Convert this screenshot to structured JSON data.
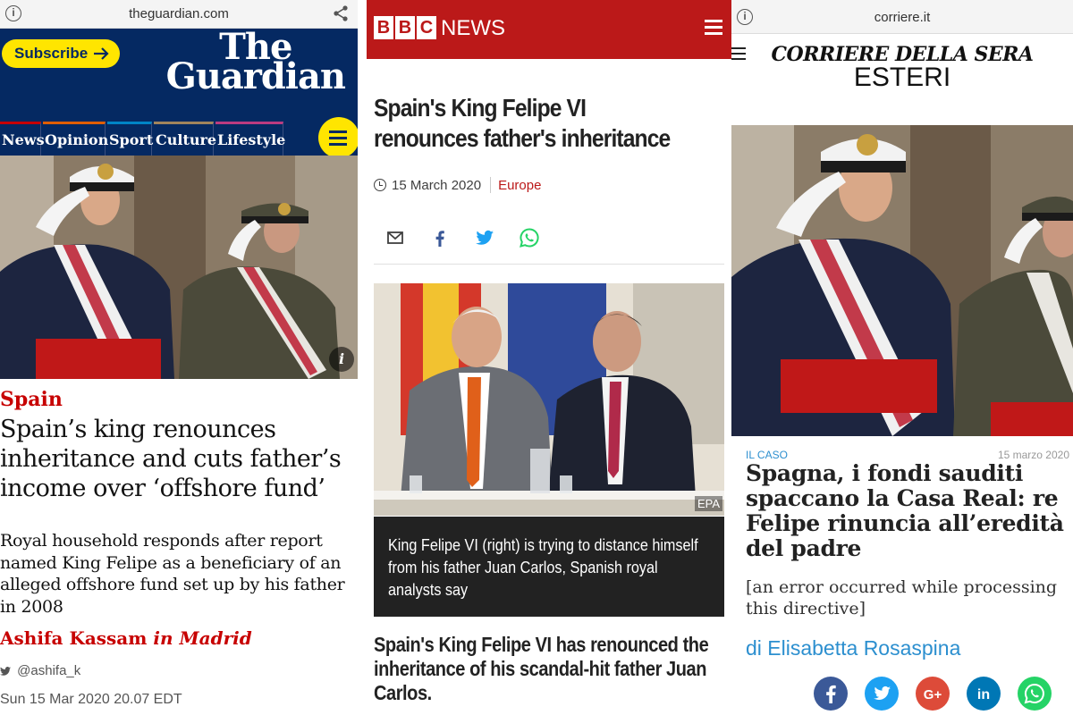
{
  "guardian": {
    "url": "theguardian.com",
    "subscribe_label": "Subscribe",
    "logo_line1": "The",
    "logo_line2": "Guardian",
    "nav": [
      {
        "label": "News",
        "color": "#c70000"
      },
      {
        "label": "Opinion",
        "color": "#e05e00"
      },
      {
        "label": "Sport",
        "color": "#0084c6"
      },
      {
        "label": "Culture",
        "color": "#a1845c"
      },
      {
        "label": "Lifestyle",
        "color": "#bb3b80"
      }
    ],
    "kicker": "Spain",
    "headline": "Spain’s king renounces inheritance and cuts father’s income over ‘offshore fund’",
    "standfirst": "Royal household responds after report named King Felipe as a beneficiary of an alleged offshore fund set up by his father in 2008",
    "byline_name": "Ashifa Kassam",
    "byline_location": "in Madrid",
    "twitter": "@ashifa_k",
    "date": "Sun 15 Mar 2020 20.07 EDT",
    "brand_color": "#052962",
    "accent_yellow": "#ffe500"
  },
  "bbc": {
    "logo_letters": [
      "B",
      "B",
      "C"
    ],
    "logo_news": "NEWS",
    "title": "Spain's King Felipe VI renounces father's inheritance",
    "date": "15 March 2020",
    "category": "Europe",
    "share_icons": [
      "email-icon",
      "facebook-icon",
      "twitter-icon",
      "whatsapp-icon"
    ],
    "photo_credit": "EPA",
    "caption": "King Felipe VI (right) is trying to distance himself from his father Juan Carlos, Spanish royal analysts say",
    "lead": "Spain's King Felipe VI has renounced the inheritance of his scandal-hit father Juan Carlos.",
    "brand_color": "#bb1919"
  },
  "corriere": {
    "url": "corriere.it",
    "brand": "CORRIERE DELLA SERA",
    "section": "ESTERI",
    "kicker": "IL CASO",
    "date": "15 marzo 2020",
    "title": "Spagna, i fondi sauditi spaccano la Casa Real: re Felipe rinuncia all’eredità del padre",
    "subtitle": "[an error occurred while processing this directive]",
    "author": "di Elisabetta Rosaspina",
    "social_icons": [
      "facebook-icon",
      "twitter-icon",
      "google-plus-icon",
      "linkedin-icon",
      "whatsapp-icon"
    ],
    "accent_color": "#2c8fcf"
  }
}
